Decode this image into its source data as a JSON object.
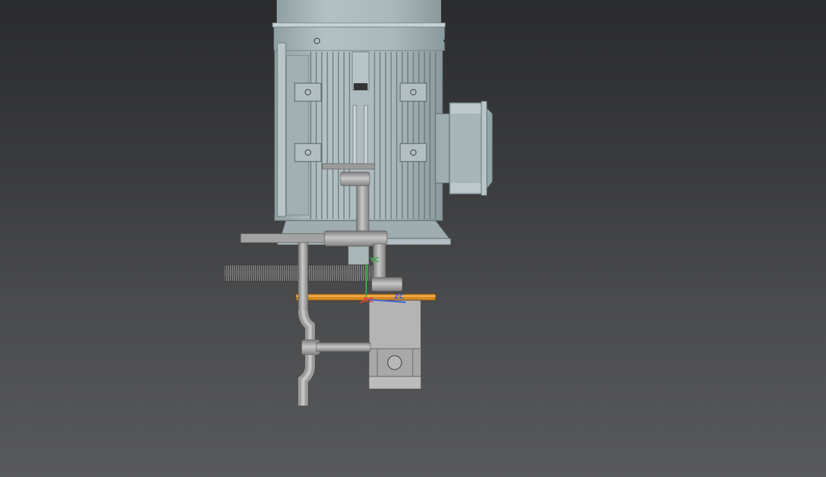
{
  "viewport": {
    "background_top": "#2a2b2d",
    "background_bottom": "#58595b"
  },
  "model": {
    "motor_body_color": "#a9b7ba",
    "motor_shadow_color": "#7f8d90",
    "gear_color": "#5e5e5e",
    "pipe_color": "#a7a7a7",
    "plate_color": "#d98a1f",
    "housing_color": "#b6b6b6"
  },
  "triad": {
    "x_label": "XC",
    "y_label": "YC",
    "z_label": "ZC",
    "x_color": "#d9452b",
    "y_color": "#3fa84a",
    "z_color": "#3f5fd9"
  }
}
